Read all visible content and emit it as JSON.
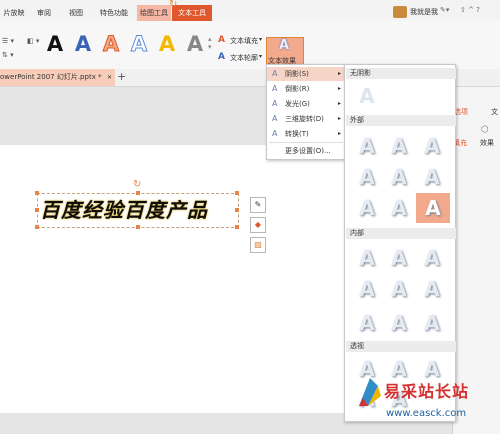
{
  "tabs": [
    "片放映",
    "审阅",
    "视图",
    "特色功能",
    "绘图工具",
    "文本工具"
  ],
  "user": {
    "name": "我就是我"
  },
  "ribbon": {
    "text_fill": "文本填充",
    "text_outline": "文本轮廓",
    "text_effect": "文本效果"
  },
  "style_letter": "A",
  "doc_tab": "owerPoint 2007 幻灯片.pptx *",
  "add_tab": "+",
  "effects_menu": {
    "items": [
      {
        "label": "阴影(S)"
      },
      {
        "label": "倒影(R)"
      },
      {
        "label": "发光(G)"
      },
      {
        "label": "三维旋转(D)"
      },
      {
        "label": "转换(T)"
      },
      {
        "label": "更多设置(O)..."
      }
    ]
  },
  "shadow_gallery": {
    "sections": [
      "无阴影",
      "外部",
      "内部",
      "透视"
    ]
  },
  "right_panel": {
    "tab1": "选项",
    "tab2": "文",
    "effects_label": "效果"
  },
  "slide_text": "百度经验百度产品",
  "watermark": {
    "text": "易采站长站",
    "url": "www.easck.com"
  },
  "colors": {
    "accent": "#e0572e",
    "context_tab": "#f6b8a4",
    "highlight": "#f3a98c"
  }
}
